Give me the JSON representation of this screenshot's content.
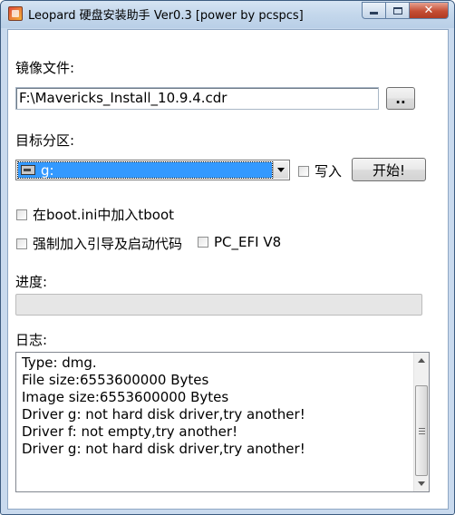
{
  "window": {
    "title": "Leopard 硬盘安装助手 Ver0.3 [power by pcspcs]",
    "close_glyph": "✕"
  },
  "image_file": {
    "label": "镜像文件:",
    "value": "F:\\Mavericks_Install_10.9.4.cdr",
    "browse_label": ".."
  },
  "target_partition": {
    "label": "目标分区:",
    "selected": "g:",
    "write_label": "写入",
    "write_checked": false,
    "start_label": "开始!"
  },
  "options": {
    "boot_ini_label": "在boot.ini中加入tboot",
    "boot_ini_checked": false,
    "force_boot_label": "强制加入引导及启动代码",
    "force_boot_checked": false,
    "pc_efi_label": "PC_EFI V8",
    "pc_efi_checked": false
  },
  "progress": {
    "label": "进度:",
    "value": 0
  },
  "log": {
    "label": "日志:",
    "lines": [
      "Type: dmg.",
      "File size:6553600000 Bytes",
      "Image size:6553600000 Bytes",
      "Driver g: not hard disk driver,try another!",
      "Driver f: not empty,try another!",
      "Driver g: not hard disk driver,try another!"
    ]
  },
  "colors": {
    "selection": "#3399ff",
    "frame": "#c9daee",
    "close_button": "#c54e34"
  },
  "icons": {
    "app": "app-icon",
    "drive": "drive-icon",
    "dropdown": "chevron-down-icon"
  }
}
